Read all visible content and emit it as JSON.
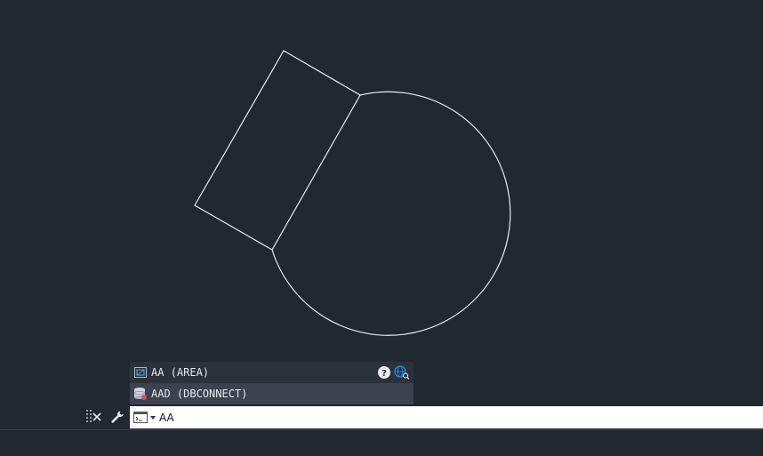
{
  "suggestions": [
    {
      "label": "AA (AREA)",
      "icon": "area-command-icon"
    },
    {
      "label": "AAD (DBCONNECT)",
      "icon": "dbconnect-icon"
    }
  ],
  "command_line": {
    "input_value": "AA"
  },
  "colors": {
    "canvas_bg": "#212830",
    "geometry_stroke": "#e8eaec",
    "help_accent": "#1e88e5"
  }
}
